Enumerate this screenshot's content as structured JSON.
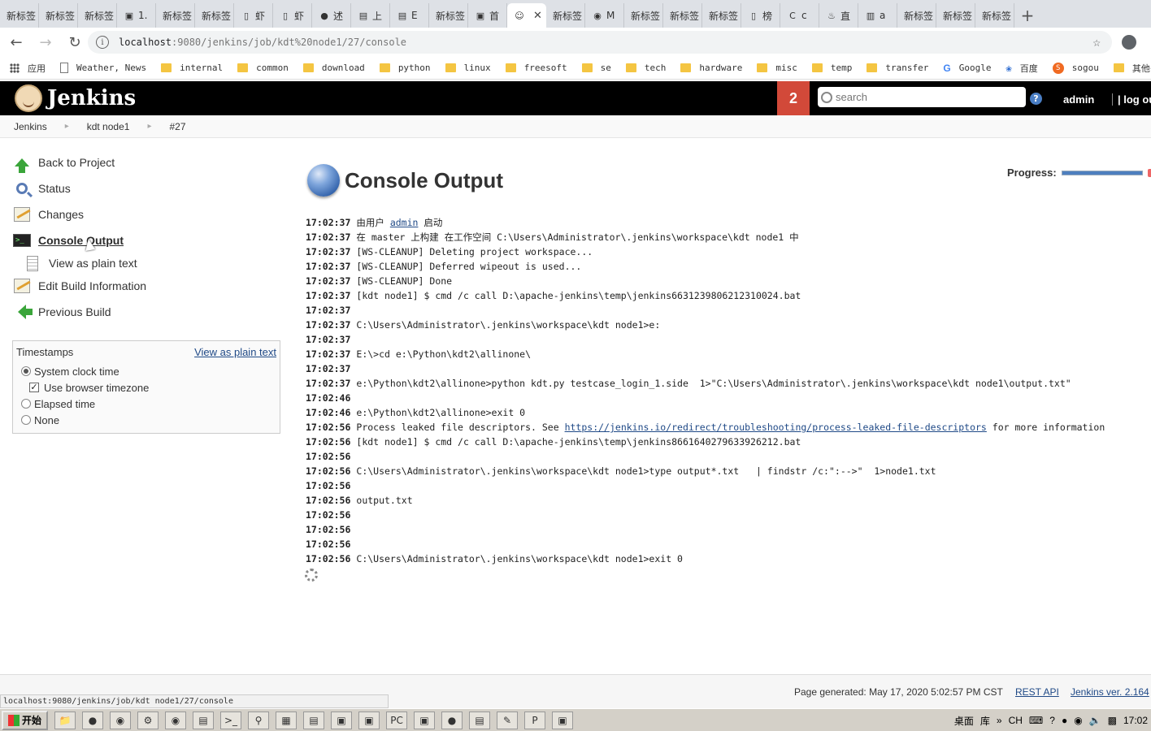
{
  "browser": {
    "tabs": [
      {
        "icon": "text",
        "label": "新标签"
      },
      {
        "icon": "text",
        "label": "新标签"
      },
      {
        "icon": "text",
        "label": "新标签"
      },
      {
        "icon": "image",
        "label": "1."
      },
      {
        "icon": "text",
        "label": "新标签"
      },
      {
        "icon": "text",
        "label": "新标签"
      },
      {
        "icon": "doc",
        "label": "虾"
      },
      {
        "icon": "doc",
        "label": "虾"
      },
      {
        "icon": "green",
        "label": "述"
      },
      {
        "icon": "sheet",
        "label": "上"
      },
      {
        "icon": "sheet",
        "label": "E"
      },
      {
        "icon": "text",
        "label": "新标签"
      },
      {
        "icon": "image",
        "label": "首"
      },
      {
        "icon": "jenkins",
        "label": ""
      },
      {
        "icon": "text",
        "label": "新标签"
      },
      {
        "icon": "zoom",
        "label": "M"
      },
      {
        "icon": "text",
        "label": "新标签"
      },
      {
        "icon": "text",
        "label": "新标签"
      },
      {
        "icon": "text",
        "label": "新标签"
      },
      {
        "icon": "doc",
        "label": "榜"
      },
      {
        "icon": "red",
        "label": "c"
      },
      {
        "icon": "flame",
        "label": "直"
      },
      {
        "icon": "book",
        "label": "a"
      },
      {
        "icon": "text",
        "label": "新标签"
      },
      {
        "icon": "text",
        "label": "新标签"
      },
      {
        "icon": "text",
        "label": "新标签"
      }
    ],
    "active_tab_index": 13,
    "url_host": "localhost",
    "url_path": ":9080/jenkins/job/kdt%20node1/27/console",
    "bookmarks": [
      {
        "icon": "grid",
        "label": "应用"
      },
      {
        "icon": "page",
        "label": "Weather, News"
      },
      {
        "icon": "folder",
        "label": "internal"
      },
      {
        "icon": "folder",
        "label": "common"
      },
      {
        "icon": "folder",
        "label": "download"
      },
      {
        "icon": "folder",
        "label": "python"
      },
      {
        "icon": "folder",
        "label": "linux"
      },
      {
        "icon": "folder",
        "label": "freesoft"
      },
      {
        "icon": "folder",
        "label": "se"
      },
      {
        "icon": "folder",
        "label": "tech"
      },
      {
        "icon": "folder",
        "label": "hardware"
      },
      {
        "icon": "folder",
        "label": "misc"
      },
      {
        "icon": "folder",
        "label": "temp"
      },
      {
        "icon": "folder",
        "label": "transfer"
      },
      {
        "icon": "google",
        "label": "Google"
      },
      {
        "icon": "paw",
        "label": "百度"
      },
      {
        "icon": "sogou",
        "label": "sogou"
      },
      {
        "icon": "folder",
        "label": "其他书签"
      }
    ]
  },
  "jenkins": {
    "logo_text": "Jenkins",
    "notification_count": "2",
    "search_placeholder": "search",
    "help": "?",
    "user": "admin",
    "logout": "| log out"
  },
  "breadcrumb": [
    "Jenkins",
    "kdt node1",
    "#27"
  ],
  "sidepanel": {
    "tasks": [
      {
        "icon": "up-arrow-icon",
        "label": "Back to Project"
      },
      {
        "icon": "magnifier-icon",
        "label": "Status"
      },
      {
        "icon": "notepad-icon",
        "label": "Changes"
      },
      {
        "icon": "terminal-icon",
        "label": "Console Output"
      },
      {
        "icon": "document-icon",
        "label": "View as plain text"
      },
      {
        "icon": "notepad-icon",
        "label": "Edit Build Information"
      },
      {
        "icon": "left-arrow-icon",
        "label": "Previous Build"
      }
    ],
    "timestamps": {
      "title": "Timestamps",
      "link": "View as plain text",
      "options": [
        "System clock time",
        "Use browser timezone",
        "Elapsed time",
        "None"
      ]
    }
  },
  "main": {
    "title": "Console Output",
    "progress_label": "Progress:",
    "progress": 1.0,
    "lines": [
      {
        "t": "17:02:37",
        "pre": "由用户 ",
        "link": "admin",
        "post": " 启动"
      },
      {
        "t": "17:02:37",
        "text": "在 master 上构建 在工作空间 C:\\Users\\Administrator\\.jenkins\\workspace\\kdt node1 中"
      },
      {
        "t": "17:02:37",
        "text": "[WS-CLEANUP] Deleting project workspace..."
      },
      {
        "t": "17:02:37",
        "text": "[WS-CLEANUP] Deferred wipeout is used..."
      },
      {
        "t": "17:02:37",
        "text": "[WS-CLEANUP] Done"
      },
      {
        "t": "17:02:37",
        "text": "[kdt node1] $ cmd /c call D:\\apache-jenkins\\temp\\jenkins6631239806212310024.bat"
      },
      {
        "t": "17:02:37",
        "text": ""
      },
      {
        "t": "17:02:37",
        "text": "C:\\Users\\Administrator\\.jenkins\\workspace\\kdt node1>e:"
      },
      {
        "t": "17:02:37",
        "text": ""
      },
      {
        "t": "17:02:37",
        "text": "E:\\>cd e:\\Python\\kdt2\\allinone\\"
      },
      {
        "t": "17:02:37",
        "text": ""
      },
      {
        "t": "17:02:37",
        "text": "e:\\Python\\kdt2\\allinone>python kdt.py testcase_login_1.side  1>\"C:\\Users\\Administrator\\.jenkins\\workspace\\kdt node1\\output.txt\""
      },
      {
        "t": "17:02:46",
        "text": ""
      },
      {
        "t": "17:02:46",
        "text": "e:\\Python\\kdt2\\allinone>exit 0"
      },
      {
        "t": "17:02:56",
        "pre": "Process leaked file descriptors. See ",
        "link": "https://jenkins.io/redirect/troubleshooting/process-leaked-file-descriptors",
        "post": " for more information"
      },
      {
        "t": "17:02:56",
        "text": "[kdt node1] $ cmd /c call D:\\apache-jenkins\\temp\\jenkins8661640279633926212.bat"
      },
      {
        "t": "17:02:56",
        "text": ""
      },
      {
        "t": "17:02:56",
        "text": "C:\\Users\\Administrator\\.jenkins\\workspace\\kdt node1>type output*.txt   | findstr /c:\":-->\"  1>node1.txt"
      },
      {
        "t": "17:02:56",
        "text": ""
      },
      {
        "t": "17:02:56",
        "text": "output.txt"
      },
      {
        "t": "17:02:56",
        "text": ""
      },
      {
        "t": "17:02:56",
        "text": ""
      },
      {
        "t": "17:02:56",
        "text": ""
      },
      {
        "t": "17:02:56",
        "text": "C:\\Users\\Administrator\\.jenkins\\workspace\\kdt node1>exit 0"
      }
    ]
  },
  "footer": {
    "page_generated": "Page generated: May 17, 2020 5:02:57 PM CST",
    "rest_api": "REST API",
    "version": "Jenkins ver. 2.164"
  },
  "status_url": "localhost:9080/jenkins/job/kdt node1/27/console",
  "taskbar": {
    "start": "开始",
    "tray": [
      "桌面",
      "库",
      "CH",
      "17:02"
    ]
  }
}
